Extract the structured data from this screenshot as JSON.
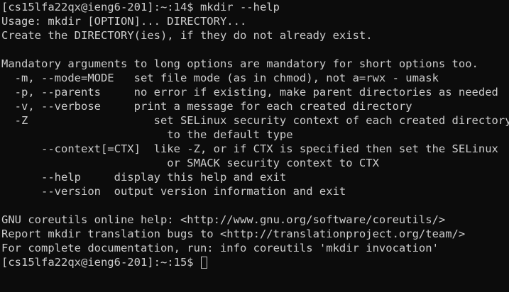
{
  "terminal": {
    "lines": [
      "[cs15lfa22qx@ieng6-201]:~:14$ mkdir --help",
      "Usage: mkdir [OPTION]... DIRECTORY...",
      "Create the DIRECTORY(ies), if they do not already exist.",
      "",
      "Mandatory arguments to long options are mandatory for short options too.",
      "  -m, --mode=MODE   set file mode (as in chmod), not a=rwx - umask",
      "  -p, --parents     no error if existing, make parent directories as needed",
      "  -v, --verbose     print a message for each created directory",
      "  -Z                   set SELinux security context of each created directory",
      "                         to the default type",
      "      --context[=CTX]  like -Z, or if CTX is specified then set the SELinux",
      "                         or SMACK security context to CTX",
      "      --help     display this help and exit",
      "      --version  output version information and exit",
      "",
      "GNU coreutils online help: <http://www.gnu.org/software/coreutils/>",
      "Report mkdir translation bugs to <http://translationproject.org/team/>",
      "For complete documentation, run: info coreutils 'mkdir invocation'"
    ],
    "prompt": "[cs15lfa22qx@ieng6-201]:~:15$ "
  }
}
